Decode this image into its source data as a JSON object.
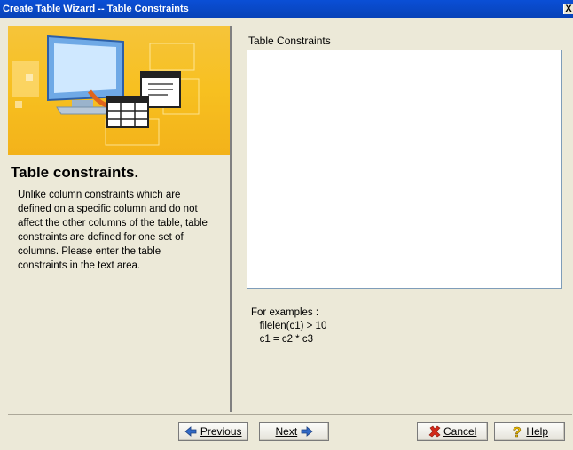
{
  "window": {
    "title": "Create Table Wizard -- Table Constraints",
    "close_label": "X"
  },
  "left": {
    "heading": "Table constraints.",
    "description": "Unlike column constraints which are\ndefined on a specific column and do not\naffect the other columns of the table, table\nconstraints are defined for one set of\ncolumns.  Please enter the table\nconstraints in the text area."
  },
  "right": {
    "label": "Table Constraints",
    "textarea_value": "",
    "examples": "For examples :\n   filelen(c1) > 10\n   c1 = c2 * c3"
  },
  "buttons": {
    "previous": "Previous",
    "next": "Next",
    "cancel": "Cancel",
    "help": "Help"
  },
  "icons": {
    "previous": "left-arrow-icon",
    "next": "right-arrow-icon",
    "cancel": "red-x-icon",
    "help": "question-mark-icon",
    "banner": "computer-table-illustration"
  },
  "colors": {
    "titlebar": "#0a4fd6",
    "banner": "#f7c020",
    "dialog_bg": "#ece9d8",
    "arrow_blue": "#3169c6",
    "cancel_red": "#d42a1a"
  }
}
